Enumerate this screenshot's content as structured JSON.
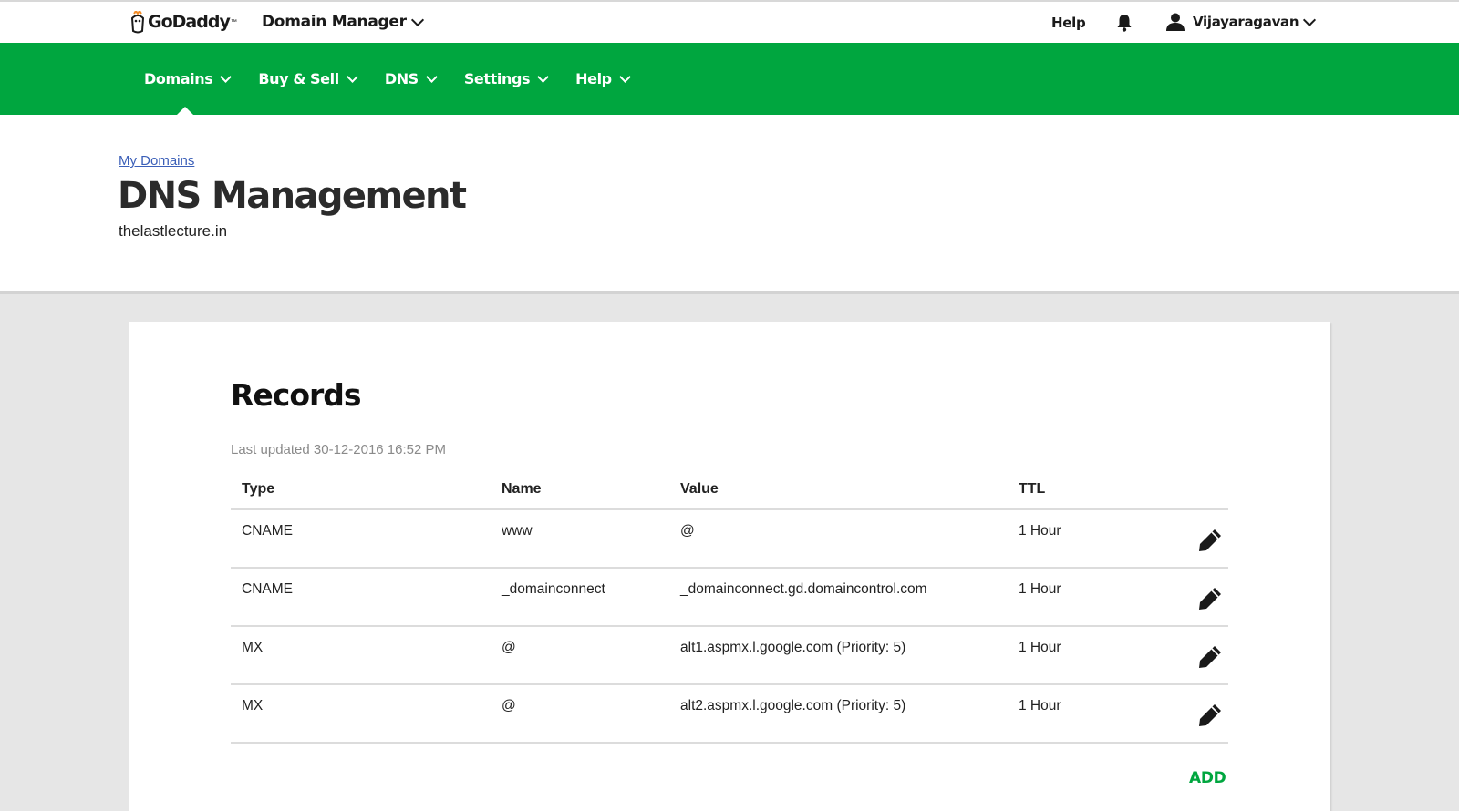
{
  "colors": {
    "brand_green": "#00a63f",
    "link_blue": "#3b5fb8"
  },
  "topbar": {
    "logo_text": "GoDaddy",
    "logo_tm": "™",
    "app_switcher": "Domain Manager",
    "help": "Help",
    "notifications_icon": "bell-icon",
    "user_name": "Vijayaragavan",
    "user_icon": "user-icon"
  },
  "nav": {
    "items": [
      {
        "label": "Domains",
        "active": true
      },
      {
        "label": "Buy & Sell"
      },
      {
        "label": "DNS"
      },
      {
        "label": "Settings"
      },
      {
        "label": "Help"
      }
    ]
  },
  "header": {
    "breadcrumb": "My Domains",
    "title": "DNS Management",
    "domain": "thelastlecture.in"
  },
  "records": {
    "title": "Records",
    "last_updated": "Last updated 30-12-2016 16:52 PM",
    "columns": [
      "Type",
      "Name",
      "Value",
      "TTL"
    ],
    "rows": [
      {
        "type": "CNAME",
        "name": "www",
        "value": "@",
        "ttl": "1 Hour"
      },
      {
        "type": "CNAME",
        "name": "_domainconnect",
        "value": "_domainconnect.gd.domaincontrol.com",
        "ttl": "1 Hour"
      },
      {
        "type": "MX",
        "name": "@",
        "value": "alt1.aspmx.l.google.com (Priority: 5)",
        "ttl": "1 Hour"
      },
      {
        "type": "MX",
        "name": "@",
        "value": "alt2.aspmx.l.google.com (Priority: 5)",
        "ttl": "1 Hour"
      }
    ],
    "edit_icon": "pencil-icon",
    "add_label": "ADD"
  }
}
